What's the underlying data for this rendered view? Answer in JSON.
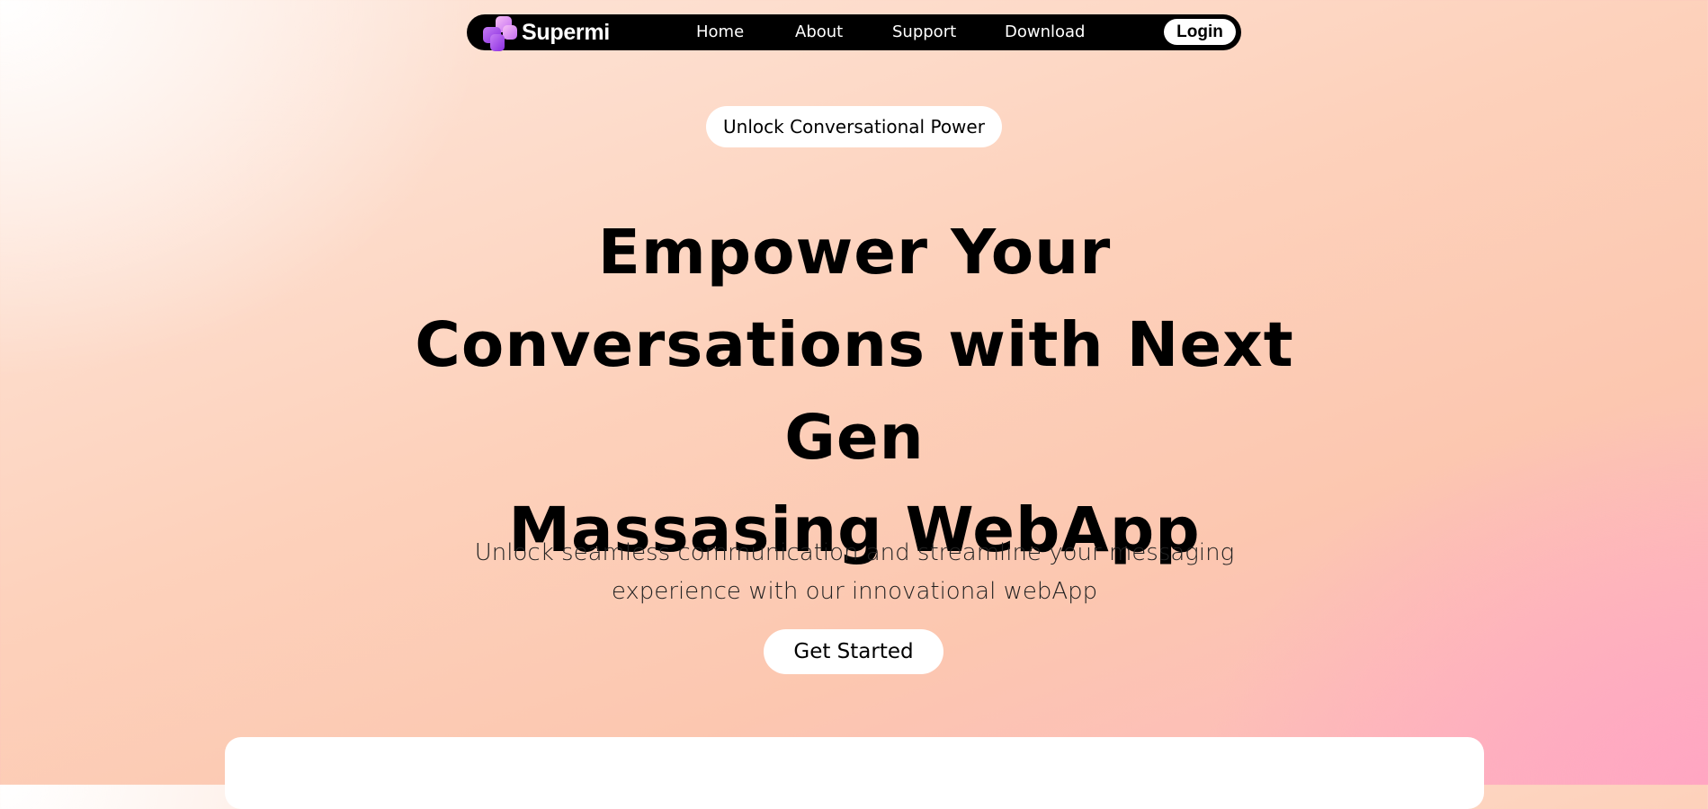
{
  "navbar": {
    "brand": "Supermi",
    "links": [
      "Home",
      "About",
      "Support",
      "Download"
    ],
    "login_label": "Login"
  },
  "hero": {
    "badge": "Unlock Conversational Power",
    "headline_lines": [
      "Empower Your",
      "Conversations with Next Gen",
      "Massasing WebApp"
    ],
    "subtitle_lines": [
      "Unlock seamless communication and streamline your messaging",
      "experience with our innovational webApp"
    ],
    "cta_label": "Get Started"
  },
  "theme": {
    "navbar_bg": "#000000",
    "logo_gradient": [
      "#f0a8f2",
      "#9b3ff0"
    ],
    "background_gradient": [
      "#ffffff",
      "#fdd1bb",
      "#ffa6c2"
    ]
  },
  "icons": {
    "logo": "puzzle-logo-icon"
  }
}
